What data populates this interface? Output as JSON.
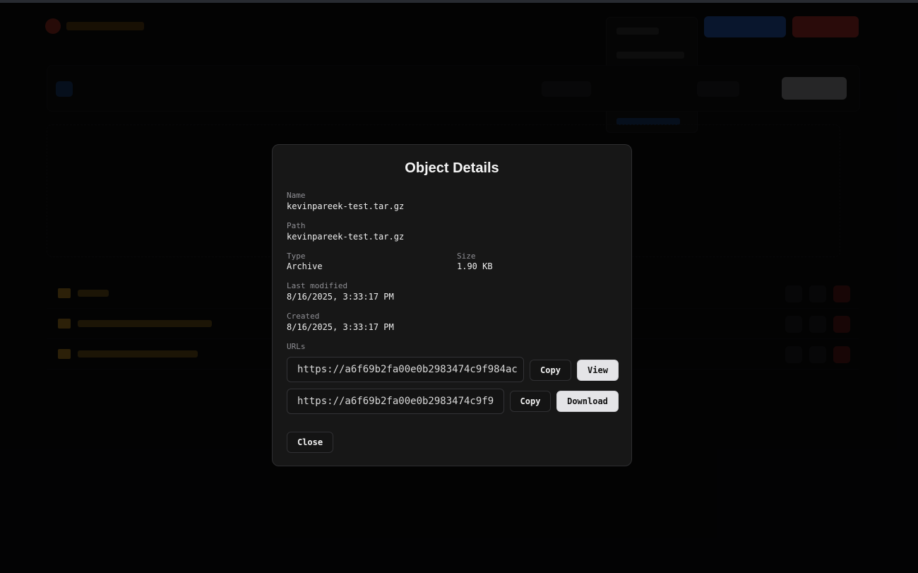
{
  "modal": {
    "title": "Object Details",
    "name_label": "Name",
    "name_value": "kevinpareek-test.tar.gz",
    "path_label": "Path",
    "path_value": "kevinpareek-test.tar.gz",
    "type_label": "Type",
    "type_value": "Archive",
    "size_label": "Size",
    "size_value": "1.90 KB",
    "modified_label": "Last modified",
    "modified_value": "8/16/2025, 3:33:17 PM",
    "created_label": "Created",
    "created_value": "8/16/2025, 3:33:17 PM",
    "urls_label": "URLs",
    "urls": [
      {
        "value": "https://a6f69b2fa00e0b2983474c9f984ac",
        "copy_label": "Copy",
        "action_label": "View"
      },
      {
        "value": "https://a6f69b2fa00e0b2983474c9f9",
        "copy_label": "Copy",
        "action_label": "Download"
      }
    ],
    "close_label": "Close"
  },
  "colors": {
    "modal_bg": "#171717",
    "backdrop": "#0d0d0e",
    "accent_blue": "#2f6fe0",
    "accent_red": "#d03a36",
    "folder_yellow": "#d9a22a"
  }
}
